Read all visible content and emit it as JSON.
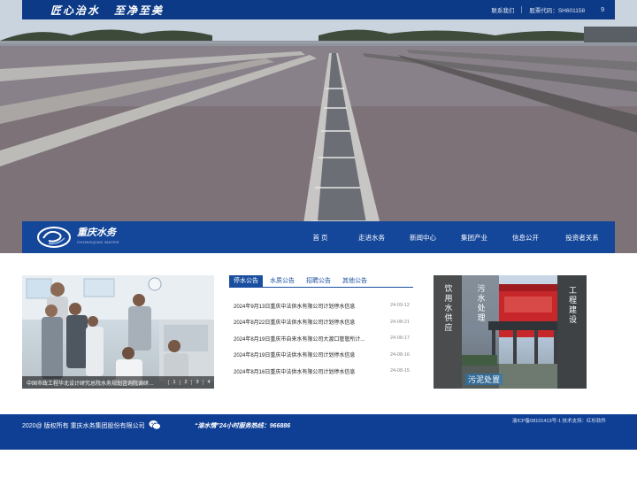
{
  "topbar": {
    "slogan_left": "匠心治水",
    "slogan_right": "至净至美",
    "contact": "联系我们",
    "stock_code": "股票代码：SH601158",
    "search": "9"
  },
  "brand": {
    "name": "重庆水务",
    "name_en": "CHONGQING WATER"
  },
  "nav": {
    "items": [
      {
        "label": "首 页"
      },
      {
        "label": "走进水务"
      },
      {
        "label": "新闻中心"
      },
      {
        "label": "集团产业"
      },
      {
        "label": "信息公开"
      },
      {
        "label": "投资者关系"
      }
    ]
  },
  "photo_news": {
    "caption": "中国市政工程华北设计研究总院水务规划咨询院调研座...",
    "pages": [
      "1",
      "2",
      "3",
      "4"
    ]
  },
  "news": {
    "tabs": [
      "停水公告",
      "水质公告",
      "招聘公告",
      "其他公告"
    ],
    "items": [
      {
        "title": "2024年9月13日重庆中法供水有限公司计划停水信息",
        "date": "24-09-12"
      },
      {
        "title": "2024年8月22日重庆中法供水有限公司计划停水信息",
        "date": "24-08-21"
      },
      {
        "title": "2024年8月19日重庆市自来水有限公司大渡口管管所计...",
        "date": "24-08-17"
      },
      {
        "title": "2024年8月19日重庆中法供水有限公司计划停水信息",
        "date": "24-08-16"
      },
      {
        "title": "2024年8月16日重庆中法供水有限公司计划停水信息",
        "date": "24-08-15"
      }
    ]
  },
  "business": {
    "supply": "饮用水供应",
    "sewage": "污水处理",
    "sludge": "污泥处置",
    "engineering": "工程建设"
  },
  "footer": {
    "copyright": "2020@ 版权所有 重庆水务集团股份有限公司",
    "hotline": "“渝水情”24小时服务热线：966886",
    "icp": "渝ICP备08101413号-1    技术支持：红杉软件"
  },
  "colors": {
    "brand_blue": "#14469a",
    "topbar_blue": "#0d3a86",
    "footer_blue": "#0f3f95",
    "business_grey": "#4a4c4d"
  }
}
